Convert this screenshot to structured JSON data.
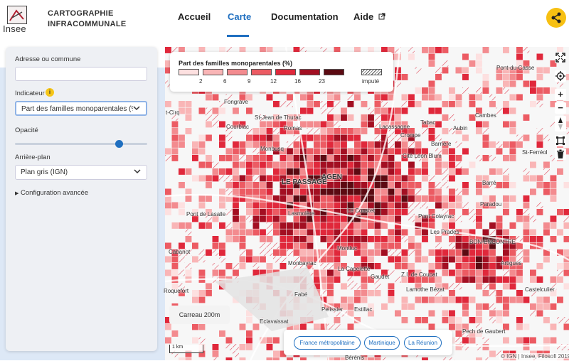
{
  "header": {
    "logo_text": "Insee",
    "app_title_line1": "CARTOGRAPHIE",
    "app_title_line2": "INFRACOMMUNALE",
    "nav": [
      {
        "label": "Accueil"
      },
      {
        "label": "Carte",
        "active": true
      },
      {
        "label": "Documentation"
      },
      {
        "label": "Aide",
        "external": true
      }
    ],
    "share_icon": "share-icon"
  },
  "panel": {
    "address_label": "Adresse ou commune",
    "address_value": "",
    "indicator_label": "Indicateur",
    "indicator_value": "Part des familles monoparentales (%",
    "opacity_label": "Opacité",
    "opacity_level": 0.85,
    "basemap_label": "Arrière-plan",
    "basemap_value": "Plan gris (IGN)",
    "advanced_label": "Configuration avancée"
  },
  "legend": {
    "title": "Part des familles monoparentales (%)",
    "classes": [
      {
        "color": "#fde0e0"
      },
      {
        "color": "#f9b5b6"
      },
      {
        "color": "#f38b8f"
      },
      {
        "color": "#ec5b63"
      },
      {
        "color": "#e0283b"
      },
      {
        "color": "#a30f22"
      },
      {
        "color": "#5c0a12"
      }
    ],
    "thresholds": [
      "2",
      "6",
      "9",
      "12",
      "16",
      "23"
    ],
    "imputed_label": "imputé"
  },
  "map": {
    "places": [
      {
        "name": "Pont-du-Casse",
        "big": false
      },
      {
        "name": "t-Cirq",
        "big": false
      },
      {
        "name": "Fongrave",
        "big": false
      },
      {
        "name": "St-Jean de Thurac",
        "big": false
      },
      {
        "name": "Courbiac",
        "big": false
      },
      {
        "name": "Romas",
        "big": false
      },
      {
        "name": "Cambes",
        "big": false
      },
      {
        "name": "Tabac",
        "big": false
      },
      {
        "name": "Aubin",
        "big": false
      },
      {
        "name": "Lacassagne",
        "big": false
      },
      {
        "name": "Crompe",
        "big": false
      },
      {
        "name": "Barrière",
        "big": false
      },
      {
        "name": "Monbusq",
        "big": false
      },
      {
        "name": "St-Ferréol",
        "big": false
      },
      {
        "name": "Cité Léon Blum",
        "big": false
      },
      {
        "name": "LE PASSAGE",
        "big": true
      },
      {
        "name": "AGEN",
        "big": true
      },
      {
        "name": "Barré",
        "big": false
      },
      {
        "name": "Paradou",
        "big": false
      },
      {
        "name": "Lasmolère",
        "big": false
      },
      {
        "name": "Le Coustet",
        "big": false
      },
      {
        "name": "Pont Colayrac",
        "big": false
      },
      {
        "name": "Pont de Lasalle",
        "big": false
      },
      {
        "name": "Les Prades",
        "big": false
      },
      {
        "name": "BON-ENCONTRE",
        "big": false
      },
      {
        "name": "Cabanot",
        "big": false
      },
      {
        "name": "Montluc",
        "big": false
      },
      {
        "name": "Monbayrac",
        "big": false
      },
      {
        "name": "Artigues",
        "big": false
      },
      {
        "name": "Gaudet",
        "big": false
      },
      {
        "name": "La Capelette",
        "big": false
      },
      {
        "name": "Z.I. de Coupat",
        "big": false
      },
      {
        "name": "Lamothe Bézat",
        "big": false
      },
      {
        "name": "Castelculier",
        "big": false
      },
      {
        "name": "Fabé",
        "big": false
      },
      {
        "name": "Pelissier",
        "big": false
      },
      {
        "name": "Estillac",
        "big": false
      },
      {
        "name": "Eclavaissat",
        "big": false
      },
      {
        "name": "Pech de Gaubert",
        "big": false
      },
      {
        "name": "Roquefort",
        "big": false
      },
      {
        "name": "Bérénis",
        "big": false
      }
    ],
    "tile_label": "Carreau 200m",
    "scale_label": "1 km",
    "attribution": "© IGN | Insee, Filosofi 2019",
    "territories": [
      {
        "label": "France métropolitaine"
      },
      {
        "label": "Martinique"
      },
      {
        "label": "La Réunion"
      }
    ],
    "controls": [
      "fullscreen-icon",
      "locate-icon",
      "zoom-in-icon",
      "zoom-out-icon",
      "north-arrow-icon",
      "select-area-icon",
      "delete-icon"
    ]
  }
}
